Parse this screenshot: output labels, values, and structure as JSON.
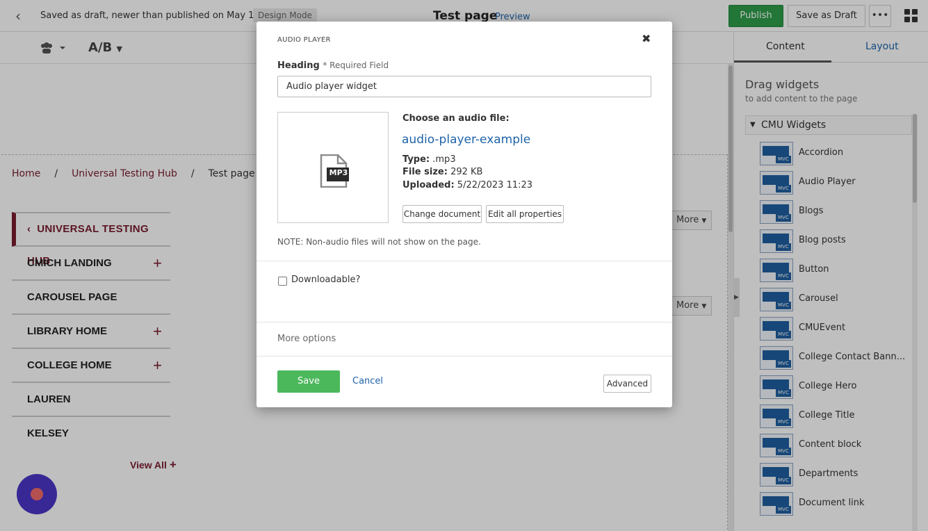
{
  "topbar": {
    "status": "Saved as draft, newer than published on May 12",
    "mode_badge": "Design Mode",
    "page_title": "Test page",
    "preview_link": "Preview",
    "publish_label": "Publish",
    "save_draft_label": "Save as Draft",
    "more_label": "•••"
  },
  "toolbar": {
    "ab_label": "A/B"
  },
  "breadcrumb": {
    "home": "Home",
    "sep": "/",
    "hub": "Universal Testing Hub",
    "current": "Test page"
  },
  "leftnav": {
    "hub_label": "UNIVERSAL TESTING HUB",
    "items": [
      {
        "label": "CMICH LANDING",
        "expandable": true
      },
      {
        "label": "CAROUSEL PAGE",
        "expandable": false
      },
      {
        "label": "LIBRARY HOME",
        "expandable": true
      },
      {
        "label": "COLLEGE HOME",
        "expandable": true
      },
      {
        "label": "LAUREN",
        "expandable": false
      },
      {
        "label": "KELSEY",
        "expandable": false
      }
    ],
    "view_all": "View All"
  },
  "canvas": {
    "more_label": "More"
  },
  "right_panel": {
    "tab_content": "Content",
    "tab_layout": "Layout",
    "title": "Drag widgets",
    "subtitle": "to add content to the page",
    "group": "CMU Widgets",
    "widgets": [
      "Accordion",
      "Audio Player",
      "Blogs",
      "Blog posts",
      "Button",
      "Carousel",
      "CMUEvent",
      "College Contact Bann...",
      "College Hero",
      "College Title",
      "Content block",
      "Departments",
      "Document link"
    ],
    "mvc_label": "MVC"
  },
  "modal": {
    "title": "AUDIO PLAYER",
    "heading_label": "Heading",
    "required_text": "* Required Field",
    "heading_value": "Audio player widget",
    "choose_label": "Choose an audio file:",
    "file_name": "audio-player-example",
    "file_badge": "MP3",
    "type_label": "Type:",
    "type_value": ".mp3",
    "size_label": "File size:",
    "size_value": "292 KB",
    "uploaded_label": "Uploaded:",
    "uploaded_value": "5/22/2023 11:23",
    "change_doc": "Change document",
    "edit_props": "Edit all properties",
    "note": "NOTE: Non-audio files will not show on the page.",
    "downloadable_label": "Downloadable?",
    "downloadable_checked": false,
    "more_options": "More options",
    "save_label": "Save",
    "cancel_label": "Cancel",
    "advanced_label": "Advanced",
    "close_symbol": "✖"
  },
  "colors": {
    "brand_maroon": "#7a1c2e",
    "publish_green": "#2e9e4a",
    "save_green": "#4cb85c",
    "link_blue": "#1f63a8"
  }
}
